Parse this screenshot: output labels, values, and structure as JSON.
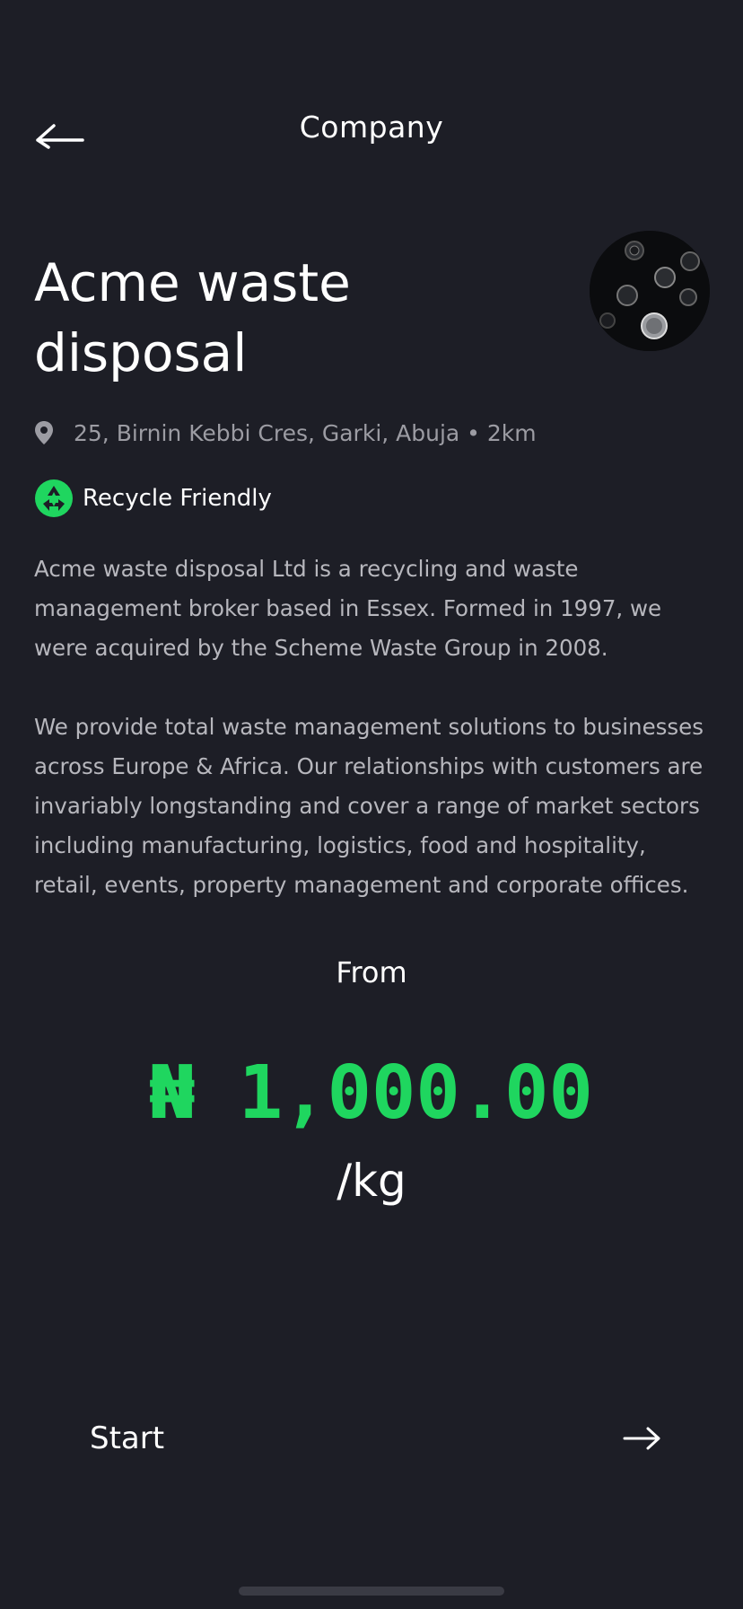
{
  "header": {
    "title": "Company",
    "back_icon": "arrow-left-icon"
  },
  "company": {
    "name": "Acme waste disposal",
    "address": "25, Birnin Kebbi Cres, Garki, Abuja • 2km",
    "badge": "Recycle Friendly",
    "description": [
      "Acme waste disposal Ltd is a recycling and waste management broker based in Essex. Formed in 1997, we were acquired by the Scheme Waste Group in 2008.",
      "We provide total waste management solutions to businesses across Europe & Africa. Our relationships with customers are invariably longstanding and cover a range of market sectors including manufacturing, logistics, food and hospitality, retail, events, property management and corporate offices."
    ]
  },
  "pricing": {
    "from_label": "From",
    "price": "₦ 1,000.00",
    "unit": "/kg"
  },
  "cta": {
    "label": "Start",
    "icon": "arrow-right-icon"
  },
  "colors": {
    "background": "#1d1e26",
    "accent": "#1fd65f",
    "muted_text": "#9c9ca3"
  }
}
